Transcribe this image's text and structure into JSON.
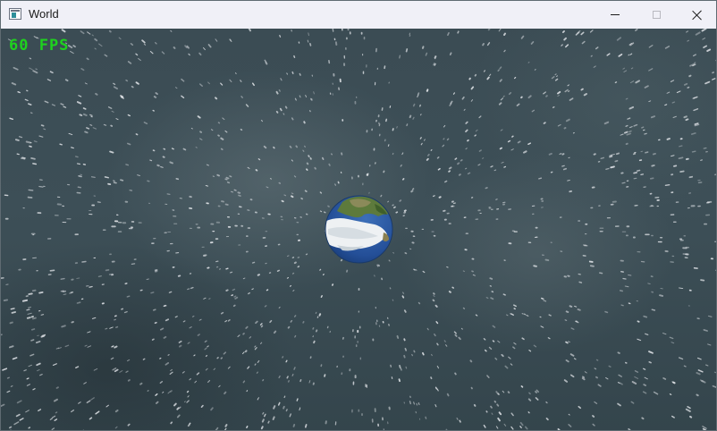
{
  "window": {
    "title": "World",
    "icon": "app-window-icon",
    "controls": {
      "minimize_icon": "minimize-icon",
      "maximize_icon": "maximize-icon",
      "close_icon": "close-icon"
    }
  },
  "scene": {
    "fps_label": "60 FPS",
    "fps_color": "#1fd11f",
    "background_color": "#3b4c54",
    "planet_name_icon": "earth-globe"
  }
}
